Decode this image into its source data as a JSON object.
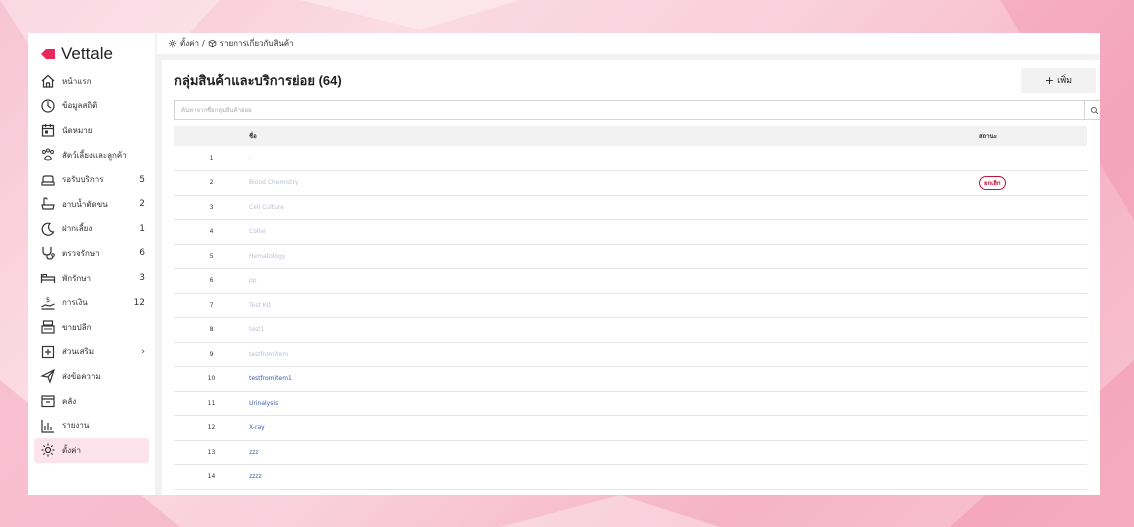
{
  "colors": {
    "accent": "#e8275c",
    "badge": "#c4133b",
    "active_bg": "#fde3ec",
    "link": "#3a5fa8",
    "muted_link": "#b6c2d6"
  },
  "app": {
    "name": "Vettale"
  },
  "sidebar": {
    "items": [
      {
        "label": "หน้าแรก",
        "icon": "home-icon",
        "count": ""
      },
      {
        "label": "ข้อมูลสถิติ",
        "icon": "dashboard-icon",
        "count": ""
      },
      {
        "label": "นัดหมาย",
        "icon": "calendar-icon",
        "count": ""
      },
      {
        "label": "สัตว์เลี้ยงและลูกค้า",
        "icon": "paw-icon",
        "count": ""
      },
      {
        "label": "รอรับบริการ",
        "icon": "sofa-icon",
        "count": "5"
      },
      {
        "label": "อาบน้ำตัดขน",
        "icon": "bathtub-icon",
        "count": "2"
      },
      {
        "label": "ฝากเลี้ยง",
        "icon": "moon-icon",
        "count": "1"
      },
      {
        "label": "ตรวจรักษา",
        "icon": "stethoscope-icon",
        "count": "6"
      },
      {
        "label": "พักรักษา",
        "icon": "bed-icon",
        "count": "3"
      },
      {
        "label": "การเงิน",
        "icon": "money-hand-icon",
        "count": "12"
      },
      {
        "label": "ขายปลีก",
        "icon": "cash-register-icon",
        "count": ""
      },
      {
        "label": "ส่วนเสริม",
        "icon": "plus-box-icon",
        "count": "›"
      },
      {
        "label": "ส่งข้อความ",
        "icon": "send-icon",
        "count": ""
      },
      {
        "label": "คลัง",
        "icon": "inbox-icon",
        "count": ""
      },
      {
        "label": "รายงาน",
        "icon": "bar-chart-icon",
        "count": ""
      },
      {
        "label": "ตั้งค่า",
        "icon": "gear-icon",
        "count": "",
        "active": true
      }
    ]
  },
  "breadcrumb": {
    "root": "ตั้งค่า",
    "separator": "/",
    "current": "รายการเกี่ยวกับสินค้า"
  },
  "panel": {
    "title": "กลุ่มสินค้าและบริการย่อย (64)",
    "add_label": "เพิ่ม",
    "search_placeholder": "ค้นหาจากชื่อกลุ่มสินค้าย่อย"
  },
  "table": {
    "headers": {
      "index": "",
      "name": "ชื่อ",
      "status": "สถานะ"
    },
    "rows": [
      {
        "index": "1",
        "name": "-",
        "status": "",
        "muted": true
      },
      {
        "index": "2",
        "name": "Blood Chemistry",
        "status": "ยกเลิก",
        "muted": true
      },
      {
        "index": "3",
        "name": "Cell Culture",
        "status": "",
        "muted": true
      },
      {
        "index": "4",
        "name": "Collar",
        "status": "",
        "muted": true
      },
      {
        "index": "5",
        "name": "Hematology",
        "status": "",
        "muted": true
      },
      {
        "index": "6",
        "name": "pp",
        "status": "",
        "muted": true
      },
      {
        "index": "7",
        "name": "Test Kit",
        "status": "",
        "muted": true
      },
      {
        "index": "8",
        "name": "test1",
        "status": "",
        "muted": true
      },
      {
        "index": "9",
        "name": "testfromitem",
        "status": "",
        "muted": true
      },
      {
        "index": "10",
        "name": "testfromitem1",
        "status": "",
        "muted": false
      },
      {
        "index": "11",
        "name": "Urinalysis",
        "status": "",
        "muted": false
      },
      {
        "index": "12",
        "name": "X-ray",
        "status": "",
        "muted": false
      },
      {
        "index": "13",
        "name": "zzz",
        "status": "",
        "muted": false
      },
      {
        "index": "14",
        "name": "zzzz",
        "status": "",
        "muted": false
      }
    ]
  }
}
